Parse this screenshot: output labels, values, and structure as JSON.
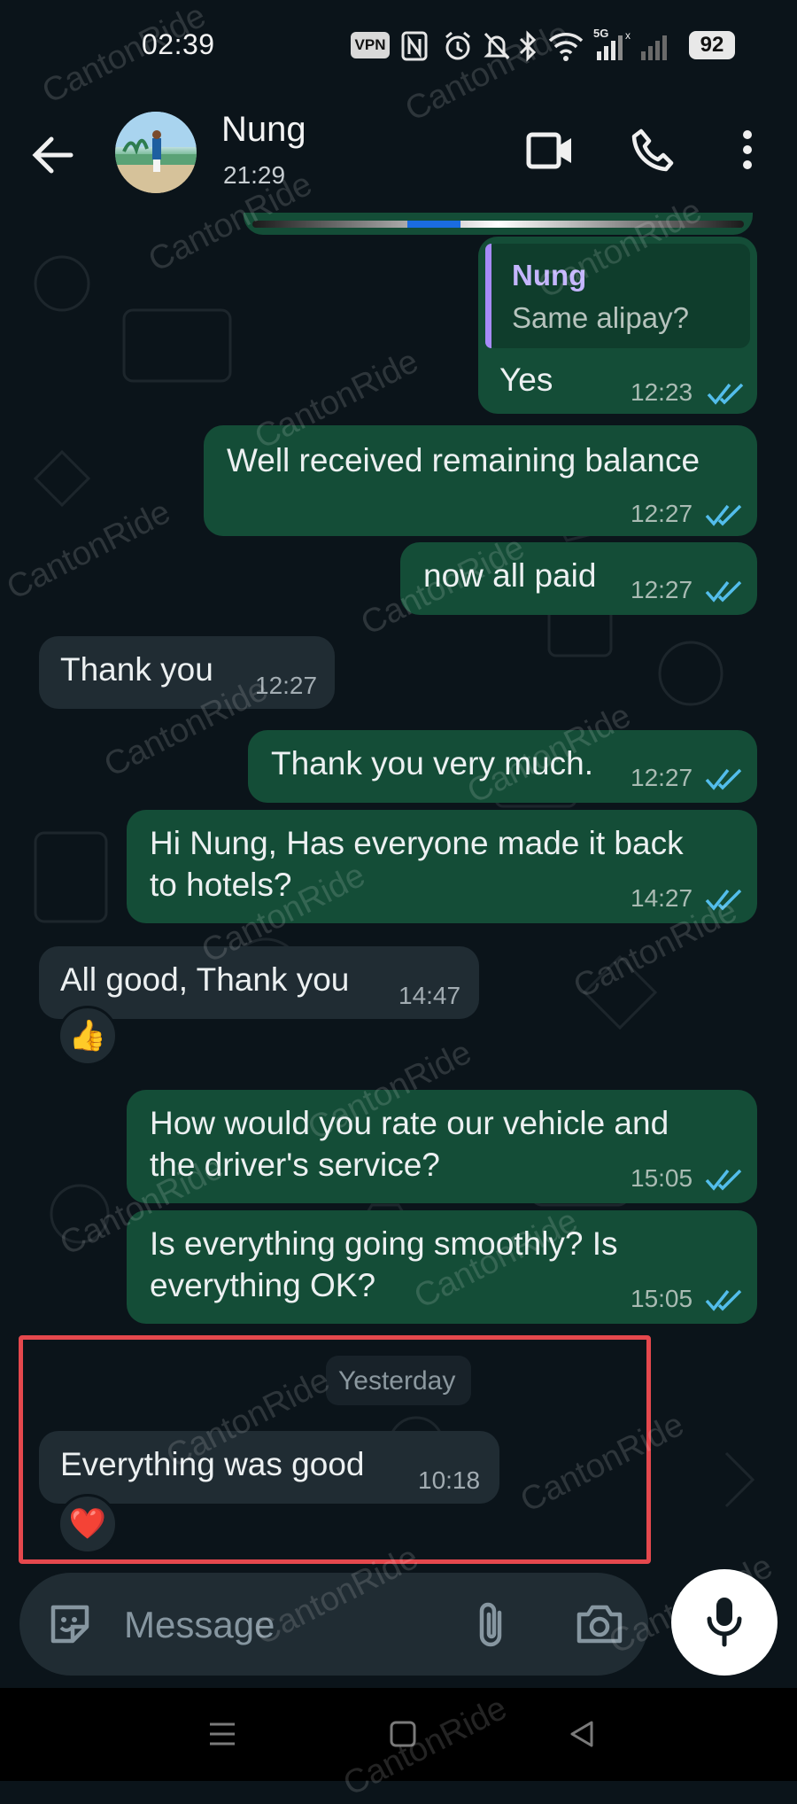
{
  "status_bar": {
    "time": "02:39",
    "vpn": "VPN",
    "signal_label": "5G",
    "battery": "92"
  },
  "header": {
    "contact_name": "Nung",
    "contact_sub": "21:29"
  },
  "messages": [
    {
      "quote_author": "Nung",
      "quote_text": "Same alipay?",
      "text": "Yes",
      "time": "12:23"
    },
    {
      "text": "Well received remaining balance",
      "time": "12:27"
    },
    {
      "text": "now all paid",
      "time": "12:27"
    },
    {
      "text": "Thank you",
      "time": "12:27"
    },
    {
      "text": "Thank you very much.",
      "time": "12:27"
    },
    {
      "line1": "Hi Nung, Has everyone made it back",
      "line2": "to hotels?",
      "time": "14:27"
    },
    {
      "text": "All good, Thank you",
      "time": "14:47",
      "reaction": "👍"
    },
    {
      "line1": "How would you rate our vehicle and",
      "line2": "the driver's service?",
      "time": "15:05"
    },
    {
      "line1": "Is everything going smoothly? Is",
      "line2": "everything OK?",
      "time": "15:05"
    },
    {
      "text": "Everything was good",
      "time": "10:18",
      "reaction": "❤️"
    }
  ],
  "date_chip": "Yesterday",
  "composer": {
    "placeholder": "Message"
  },
  "watermark": "CantonRide",
  "colors": {
    "background": "#0b141a",
    "outgoing_bubble": "#144d37",
    "incoming_bubble": "#202c33",
    "read_ticks": "#53bdeb",
    "highlight_border": "#e5484d"
  }
}
